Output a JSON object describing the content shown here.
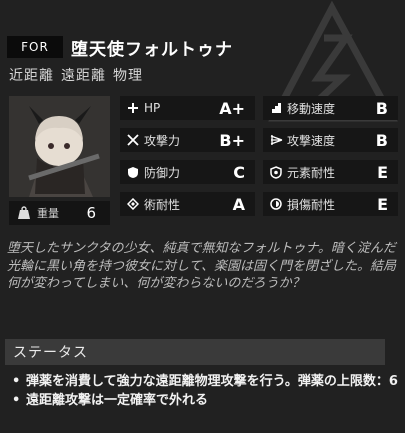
{
  "header": {
    "for_label": "FOR",
    "name": "堕天使フォルトゥナ"
  },
  "tags": [
    "近距離",
    "遠距離",
    "物理"
  ],
  "weight": {
    "label": "重量",
    "value": "6"
  },
  "stats": [
    {
      "label": "HP",
      "value": "A+",
      "icon": "plus-icon"
    },
    {
      "label": "移動速度",
      "value": "B",
      "icon": "stairs-icon"
    },
    {
      "label": "攻撃力",
      "value": "B+",
      "icon": "crossed-swords-icon"
    },
    {
      "label": "攻撃速度",
      "value": "B",
      "icon": "speed-lines-icon"
    },
    {
      "label": "防御力",
      "value": "C",
      "icon": "shield-icon"
    },
    {
      "label": "元素耐性",
      "value": "E",
      "icon": "element-shield-icon"
    },
    {
      "label": "術耐性",
      "value": "A",
      "icon": "diamond-icon"
    },
    {
      "label": "損傷耐性",
      "value": "E",
      "icon": "swirl-icon"
    }
  ],
  "description": "堕天したサンクタの少女、純真で無知なフォルトゥナ。暗く淀んだ光輪に黒い角を持つ彼女に対して、楽園は固く門を閉ざした。結局何が変わってしまい、何が変わらないのだろうか？",
  "status_section": {
    "title": "ステータス"
  },
  "status_bullets": [
    "弾薬を消費して強力な遠距離物理攻撃を行う。弾薬の上限数：6",
    "遠距離攻撃は一定確率で外れる"
  ]
}
